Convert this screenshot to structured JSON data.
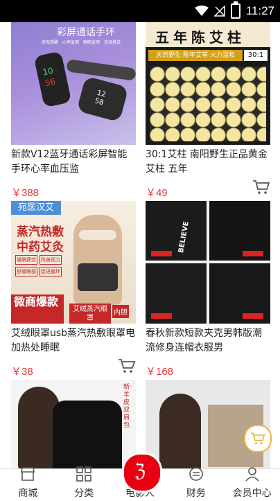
{
  "statusbar": {
    "time": "11:27"
  },
  "products": [
    {
      "title": "新款V12蓝牙通话彩屏智能手环心率血压监",
      "price": "￥388",
      "image_text": {
        "heading": "彩屏通话手环",
        "subs": [
          "来电提醒",
          "心率监测",
          "睡眠监测",
          "信息推送"
        ],
        "time_top": "10",
        "time_bottom": "56",
        "time_right1": "12",
        "time_right2": "58"
      }
    },
    {
      "title": "30:1艾柱 南阳野生正品黄金艾柱 五年",
      "price": "￥49",
      "image_text": {
        "heading": "五年陈艾柱",
        "ribbon": "天然野生·陈年艾草·火力温和",
        "ratio": "30:1"
      }
    },
    {
      "title": "艾绒眼罩usb蒸汽热敷眼罩电加热处睡眠",
      "price": "￥38",
      "image_text": {
        "brand": "宛医汉艾",
        "line1": "蒸汽热敷",
        "line2": "中药艾灸",
        "chips": [
          "缓解疲劳",
          "改善视力",
          "舒缓眼部",
          "促进循环"
        ],
        "cta": "微商爆款",
        "badge": "艾绒蒸汽眼罩",
        "badge2": "内胆"
      }
    },
    {
      "title": "春秋新款短款夹克男韩版潮流修身连帽衣服男",
      "price": "￥168",
      "image_text": {
        "back_print": "BELIEVE"
      }
    },
    {
      "title": "",
      "price": "",
      "image_text": {
        "vertical": "新·羊皮双肩包"
      }
    },
    {
      "title": "",
      "price": "",
      "image_text": {}
    }
  ],
  "bottomnav": {
    "items": [
      {
        "label": "商城",
        "icon": "store-icon"
      },
      {
        "label": "分类",
        "icon": "grid-icon"
      },
      {
        "label": "电影人",
        "icon": "movie-logo-icon"
      },
      {
        "label": "财务",
        "icon": "coin-icon"
      },
      {
        "label": "会员中心",
        "icon": "user-icon"
      }
    ]
  },
  "colors": {
    "price": "#e4393c",
    "accent": "#e60012"
  }
}
